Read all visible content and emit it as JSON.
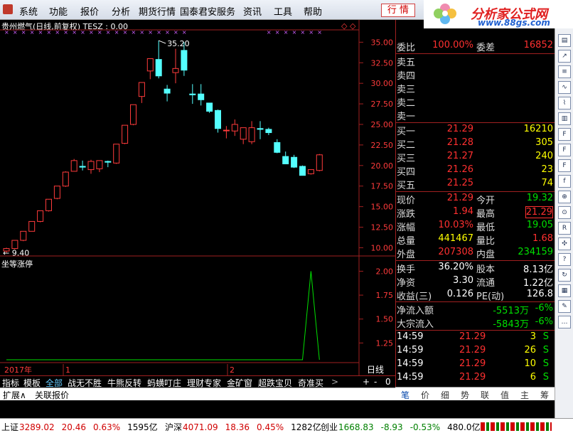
{
  "menu": {
    "items": [
      "系统",
      "功能",
      "报价",
      "分析",
      "期货行情",
      "国泰君安服务",
      "资讯",
      "工具",
      "帮助"
    ],
    "quote_button": "行 情"
  },
  "brand": {
    "title": "分析家公式网",
    "url": "www.88gs.com"
  },
  "chart": {
    "title": "贵州燃气(日线,前复权) TESZ : 0.00",
    "high_label": "35.20",
    "low_label": "9.40",
    "y_ticks": [
      "35.00",
      "32.50",
      "30.00",
      "27.50",
      "25.00",
      "22.50",
      "20.00",
      "17.50",
      "15.00",
      "12.50",
      "10.00"
    ],
    "x_labels": [
      "2017年",
      "1",
      "2"
    ],
    "period": "日线"
  },
  "chart_data": {
    "type": "candlestick",
    "candles": [
      {
        "o": 9.6,
        "h": 10.0,
        "l": 9.4,
        "c": 9.9
      },
      {
        "o": 9.9,
        "h": 10.9,
        "l": 9.8,
        "c": 10.9
      },
      {
        "o": 10.9,
        "h": 12.0,
        "l": 10.8,
        "c": 12.0
      },
      {
        "o": 12.0,
        "h": 13.2,
        "l": 12.0,
        "c": 13.2
      },
      {
        "o": 13.2,
        "h": 14.5,
        "l": 13.1,
        "c": 14.5
      },
      {
        "o": 14.5,
        "h": 15.9,
        "l": 14.4,
        "c": 15.9
      },
      {
        "o": 16.0,
        "h": 17.5,
        "l": 15.9,
        "c": 17.5
      },
      {
        "o": 17.5,
        "h": 19.3,
        "l": 17.4,
        "c": 19.2
      },
      {
        "o": 19.3,
        "h": 20.8,
        "l": 19.3,
        "c": 20.6
      },
      {
        "o": 19.9,
        "h": 20.6,
        "l": 19.4,
        "c": 19.8
      },
      {
        "o": 19.5,
        "h": 20.7,
        "l": 19.0,
        "c": 20.5
      },
      {
        "o": 19.6,
        "h": 20.6,
        "l": 19.2,
        "c": 20.6
      },
      {
        "o": 20.5,
        "h": 20.6,
        "l": 19.8,
        "c": 20.4
      },
      {
        "o": 20.3,
        "h": 22.6,
        "l": 20.2,
        "c": 22.6
      },
      {
        "o": 22.7,
        "h": 24.9,
        "l": 22.6,
        "c": 24.9
      },
      {
        "o": 25.0,
        "h": 27.4,
        "l": 24.9,
        "c": 27.4
      },
      {
        "o": 28.4,
        "h": 30.1,
        "l": 27.6,
        "c": 30.1
      },
      {
        "o": 31.5,
        "h": 33.0,
        "l": 30.5,
        "c": 33.0
      },
      {
        "o": 32.9,
        "h": 35.2,
        "l": 30.6,
        "c": 30.9
      },
      {
        "o": 29.3,
        "h": 29.8,
        "l": 27.8,
        "c": 28.8
      },
      {
        "o": 31.3,
        "h": 34.2,
        "l": 30.0,
        "c": 31.8
      },
      {
        "o": 34.0,
        "h": 35.0,
        "l": 30.9,
        "c": 31.6
      },
      {
        "o": 28.7,
        "h": 29.9,
        "l": 27.5,
        "c": 28.6
      },
      {
        "o": 28.7,
        "h": 29.9,
        "l": 27.3,
        "c": 28.0
      },
      {
        "o": 27.6,
        "h": 27.6,
        "l": 26.4,
        "c": 26.6
      },
      {
        "o": 26.7,
        "h": 26.8,
        "l": 24.0,
        "c": 24.5
      },
      {
        "o": 24.3,
        "h": 24.8,
        "l": 23.3,
        "c": 24.3
      },
      {
        "o": 24.2,
        "h": 25.6,
        "l": 23.6,
        "c": 25.0
      },
      {
        "o": 23.2,
        "h": 24.6,
        "l": 22.6,
        "c": 24.6
      },
      {
        "o": 22.9,
        "h": 25.4,
        "l": 22.6,
        "c": 24.6
      },
      {
        "o": 24.5,
        "h": 25.4,
        "l": 23.2,
        "c": 24.4
      },
      {
        "o": 24.4,
        "h": 24.6,
        "l": 23.7,
        "c": 24.0
      },
      {
        "o": 22.8,
        "h": 23.2,
        "l": 21.5,
        "c": 21.6
      },
      {
        "o": 21.1,
        "h": 21.7,
        "l": 20.2,
        "c": 20.2
      },
      {
        "o": 21.0,
        "h": 21.3,
        "l": 19.7,
        "c": 19.8
      },
      {
        "o": 19.9,
        "h": 20.0,
        "l": 18.8,
        "c": 18.8
      },
      {
        "o": 19.0,
        "h": 19.5,
        "l": 18.9,
        "c": 19.5
      },
      {
        "o": 19.4,
        "h": 21.4,
        "l": 19.3,
        "c": 21.3
      }
    ],
    "indicator": {
      "name": "坐等涨停",
      "values": [
        0,
        0,
        0,
        0,
        0,
        0,
        0,
        0,
        0,
        0,
        0,
        0,
        0,
        0,
        0,
        0,
        0,
        0,
        0,
        0,
        0,
        0,
        0,
        0,
        0,
        0,
        0,
        0,
        0,
        0,
        0,
        0,
        0,
        0,
        0,
        0,
        2,
        0
      ],
      "y_ticks": [
        "2.00",
        "1.75",
        "1.50",
        "1.25"
      ],
      "ylim": [
        1.0,
        2.1
      ]
    },
    "ylim": [
      9.0,
      36.5
    ]
  },
  "quote": {
    "stock_name": "贵州燃气",
    "webi": {
      "label": "委比",
      "value": "100.00%",
      "label2": "委差",
      "value2": "16852"
    },
    "sells": [
      {
        "label": "卖五"
      },
      {
        "label": "卖四"
      },
      {
        "label": "卖三"
      },
      {
        "label": "卖二"
      },
      {
        "label": "卖一"
      }
    ],
    "buys": [
      {
        "label": "买一",
        "price": "21.29",
        "vol": "16210"
      },
      {
        "label": "买二",
        "price": "21.28",
        "vol": "305"
      },
      {
        "label": "买三",
        "price": "21.27",
        "vol": "240"
      },
      {
        "label": "买四",
        "price": "21.26",
        "vol": "23"
      },
      {
        "label": "买五",
        "price": "21.25",
        "vol": "74"
      }
    ],
    "stats": [
      {
        "l1": "现价",
        "v1": "21.29",
        "c1": "red",
        "l2": "今开",
        "v2": "19.32",
        "c2": "green"
      },
      {
        "l1": "涨跌",
        "v1": "1.94",
        "c1": "red",
        "l2": "最高",
        "v2": "21.29",
        "c2": "red"
      },
      {
        "l1": "涨幅",
        "v1": "10.03%",
        "c1": "red",
        "l2": "最低",
        "v2": "19.05",
        "c2": "green"
      },
      {
        "l1": "总量",
        "v1": "441467",
        "c1": "yellow",
        "l2": "量比",
        "v2": "1.68",
        "c2": "red"
      },
      {
        "l1": "外盘",
        "v1": "207308",
        "c1": "red",
        "l2": "内盘",
        "v2": "234159",
        "c2": "green"
      }
    ],
    "stats2": [
      {
        "l1": "换手",
        "v1": "36.20%",
        "l2": "股本",
        "v2": "8.13亿"
      },
      {
        "l1": "净资",
        "v1": "3.30",
        "l2": "流通",
        "v2": "1.22亿"
      },
      {
        "l1": "收益(三)",
        "v1": "0.126",
        "l2": "PE(动)",
        "v2": "126.8"
      }
    ],
    "flows": [
      {
        "label": "净流入额",
        "value": "-5513万",
        "pct": "-6%"
      },
      {
        "label": "大宗流入",
        "value": "-5843万",
        "pct": "-6%"
      }
    ],
    "ticks": [
      {
        "time": "14:59",
        "price": "21.29",
        "vol": "3",
        "side": "S"
      },
      {
        "time": "14:59",
        "price": "21.29",
        "vol": "26",
        "side": "S"
      },
      {
        "time": "14:59",
        "price": "21.29",
        "vol": "10",
        "side": "S"
      },
      {
        "time": "14:59",
        "price": "21.29",
        "vol": "6",
        "side": "S"
      }
    ]
  },
  "tabs": [
    "指标",
    "模板",
    "全部",
    "战无不胜",
    "牛熊反转",
    "蚂蟥叮庄",
    "理财专家",
    "金矿窗",
    "超跌宝贝",
    "奇准买"
  ],
  "tab_controls": [
    "+",
    "-",
    "0"
  ],
  "ext": {
    "expand": "扩展∧",
    "related": "关联报价"
  },
  "bottom_tabs": [
    "笔",
    "价",
    "细",
    "势",
    "联",
    "值",
    "主",
    "筹"
  ],
  "status": [
    {
      "name": "上证",
      "price": "3289.02",
      "chg": "20.46",
      "pct": "0.63%",
      "amt": "1595亿",
      "dir": "up"
    },
    {
      "name": "沪深",
      "price": "4071.09",
      "chg": "18.36",
      "pct": "0.45%",
      "amt": "1282亿",
      "dir": "up"
    },
    {
      "name": "创业",
      "price": "1668.83",
      "chg": "-8.93",
      "pct": "-0.53%",
      "amt": "480.0亿",
      "dir": "down"
    }
  ]
}
